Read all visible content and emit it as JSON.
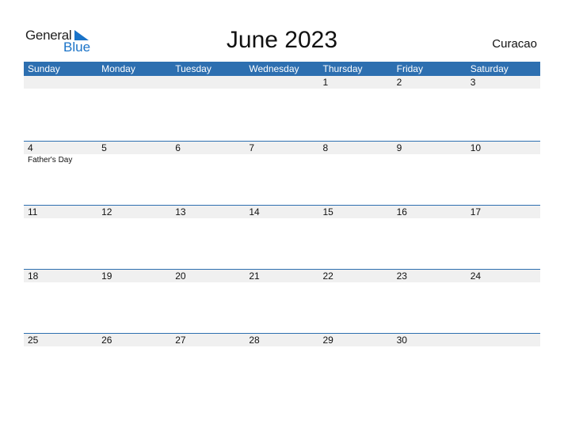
{
  "logo": {
    "general": "General",
    "blue": "Blue"
  },
  "title": "June 2023",
  "country": "Curacao",
  "colors": {
    "header": "#2d6fb0",
    "strip": "#f0f0f0",
    "logo_blue": "#1a73c8"
  },
  "weekdays": [
    "Sunday",
    "Monday",
    "Tuesday",
    "Wednesday",
    "Thursday",
    "Friday",
    "Saturday"
  ],
  "weeks": [
    {
      "days": [
        "",
        "",
        "",
        "",
        "1",
        "2",
        "3"
      ],
      "events": [
        "",
        "",
        "",
        "",
        "",
        "",
        ""
      ]
    },
    {
      "days": [
        "4",
        "5",
        "6",
        "7",
        "8",
        "9",
        "10"
      ],
      "events": [
        "Father's Day",
        "",
        "",
        "",
        "",
        "",
        ""
      ]
    },
    {
      "days": [
        "11",
        "12",
        "13",
        "14",
        "15",
        "16",
        "17"
      ],
      "events": [
        "",
        "",
        "",
        "",
        "",
        "",
        ""
      ]
    },
    {
      "days": [
        "18",
        "19",
        "20",
        "21",
        "22",
        "23",
        "24"
      ],
      "events": [
        "",
        "",
        "",
        "",
        "",
        "",
        ""
      ]
    },
    {
      "days": [
        "25",
        "26",
        "27",
        "28",
        "29",
        "30",
        ""
      ],
      "events": [
        "",
        "",
        "",
        "",
        "",
        "",
        ""
      ]
    }
  ]
}
